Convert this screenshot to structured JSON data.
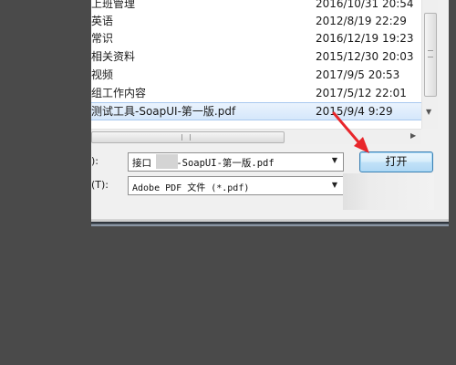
{
  "file_list": [
    {
      "name": "上班管理",
      "date": "2016/10/31 20:54"
    },
    {
      "name": "英语",
      "date": "2012/8/19 22:29"
    },
    {
      "name": "常识",
      "date": "2016/12/19 19:23"
    },
    {
      "name": "相关资料",
      "date": "2015/12/30 20:03"
    },
    {
      "name": "视频",
      "date": "2017/9/5 20:53"
    },
    {
      "name": "组工作内容",
      "date": "2017/5/12 22:01"
    },
    {
      "name": "测试工具-SoapUI-第一版.pdf",
      "date": "2015/9/4 9:29",
      "selected": true
    }
  ],
  "filename_field": {
    "label": "):",
    "value": "接口    工具-SoapUI-第一版.pdf"
  },
  "filetype_field": {
    "label": "(T):",
    "value": "Adobe PDF 文件 (*.pdf)"
  },
  "open_button": {
    "label": "打开"
  },
  "icons": {
    "dropdown": "chevron-down-icon",
    "annotation": "red-arrow-icon"
  },
  "colors": {
    "annotation_arrow": "#e8262b",
    "selection": "#d5e7fb",
    "button_border": "#3c7fb1"
  }
}
